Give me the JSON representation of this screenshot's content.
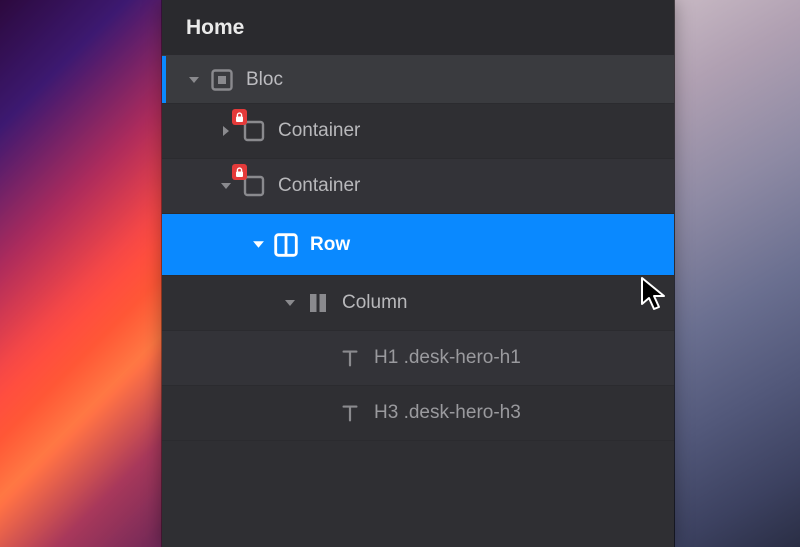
{
  "header": {
    "title": "Home"
  },
  "tree": {
    "bloc": {
      "label": "Bloc"
    },
    "container1": {
      "label": "Container"
    },
    "container2": {
      "label": "Container"
    },
    "row": {
      "label": "Row"
    },
    "column": {
      "label": "Column"
    },
    "h1": {
      "label": "H1 .desk-hero-h1"
    },
    "h3": {
      "label": "H3 .desk-hero-h3"
    }
  },
  "colors": {
    "selection": "#0a89ff",
    "lock_badge": "#e43a3a"
  }
}
